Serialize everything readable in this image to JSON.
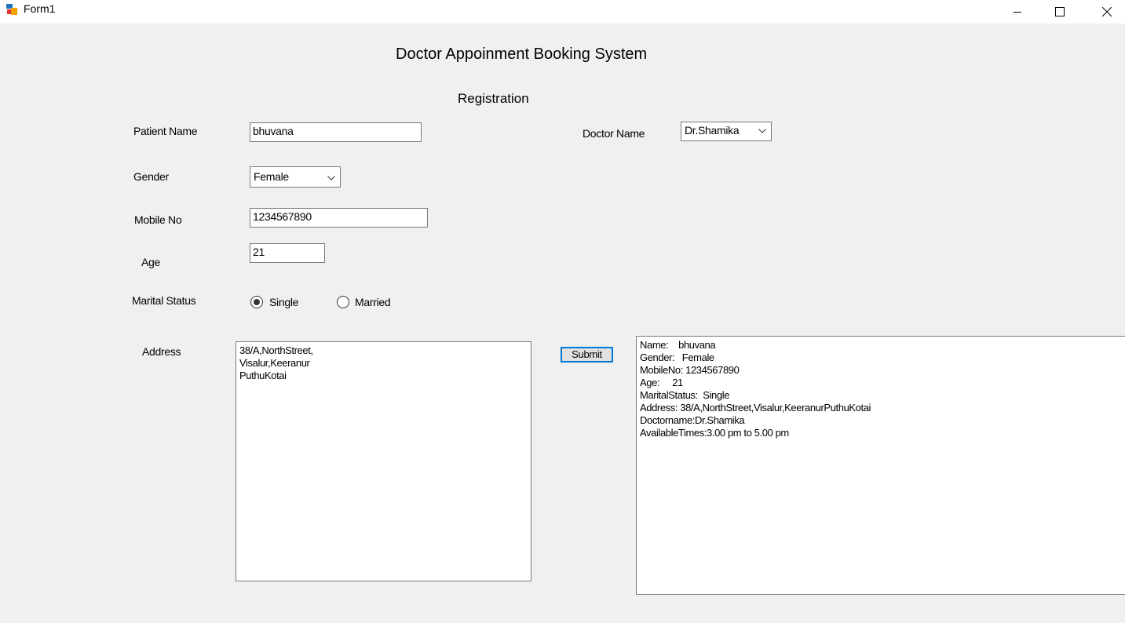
{
  "window": {
    "title": "Form1",
    "minimize_icon": "minimize-icon",
    "maximize_icon": "maximize-icon",
    "close_icon": "close-icon"
  },
  "form": {
    "heading": "Doctor Appoinment Booking System",
    "subheading": "Registration",
    "patient_name_label": "Patient Name",
    "patient_name_value": "bhuvana",
    "gender_label": "Gender",
    "gender_value": "Female",
    "mobile_label": "Mobile No",
    "mobile_value": "1234567890",
    "age_label": "Age",
    "age_value": "21",
    "marital_label": "Marital Status",
    "marital_options": [
      {
        "label": "Single",
        "selected": true
      },
      {
        "label": "Married",
        "selected": false
      }
    ],
    "address_label": "Address",
    "address_lines": [
      "38/A,NorthStreet,",
      "Visalur,Keeranur",
      "PuthuKotai"
    ],
    "doctor_label": "Doctor Name",
    "doctor_value": "Dr.Shamika",
    "submit_label": "Submit"
  },
  "output": {
    "lines": [
      "Name:    bhuvana",
      "Gender:   Female",
      "MobileNo: 1234567890",
      "Age:     21",
      "MaritalStatus:  Single",
      "Address: 38/A,NorthStreet,Visalur,KeeranurPuthuKotai",
      "Doctorname:Dr.Shamika",
      "AvailableTimes:3.00 pm to 5.00 pm"
    ]
  },
  "colors": {
    "background": "#f0f0f0",
    "focus_border": "#0078d7"
  }
}
